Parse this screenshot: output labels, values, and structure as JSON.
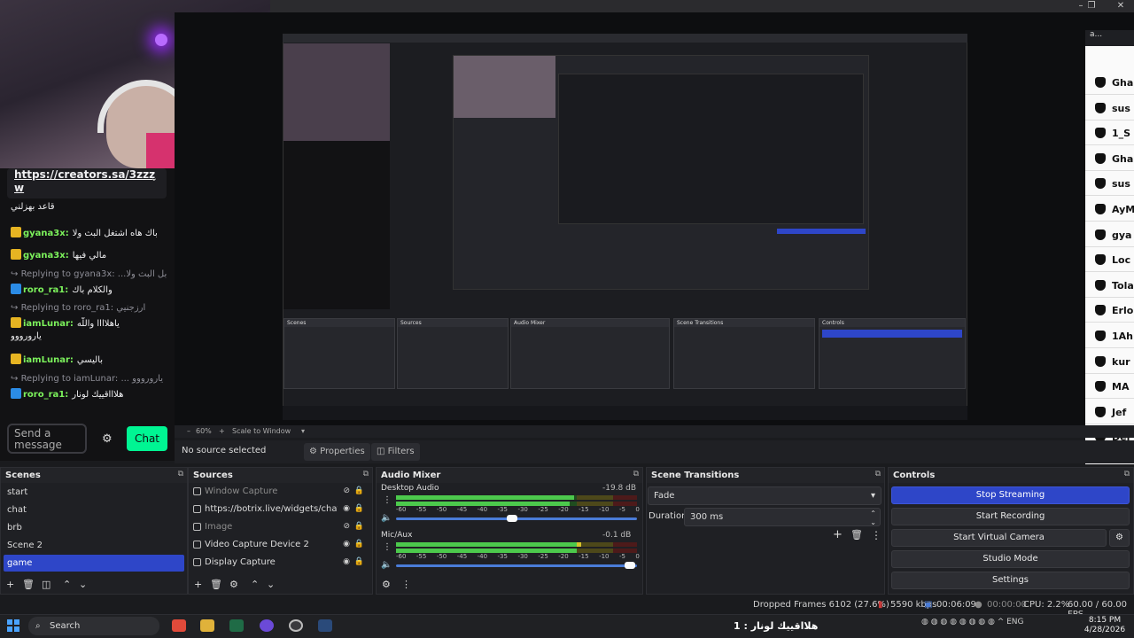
{
  "window": {
    "minimize": "–",
    "maximize": "❐",
    "close": "✕"
  },
  "chat": {
    "link": "https://creators.sa/3zzzw",
    "link_line1": "https://creators.sa/3zzz",
    "link_line2": "w",
    "messages": [
      {
        "kind": "text",
        "text": "قاعد بهزلني"
      },
      {
        "kind": "msg",
        "user": "gyana3x:",
        "text": "باك هاه اشتغل البث ولا",
        "user_color": "#7cf25c"
      },
      {
        "kind": "msg",
        "user": "gyana3x:",
        "text": "مالي فيها",
        "user_color": "#7cf25c"
      },
      {
        "kind": "reply",
        "text": "Replying to gyana3x: ...بل البث ولا"
      },
      {
        "kind": "msg",
        "user": "roro_ra1:",
        "text": "والكلام باك",
        "user_color": "#7cf25c"
      },
      {
        "kind": "reply",
        "text": "Replying to roro_ra1: ارزجنيي"
      },
      {
        "kind": "msg",
        "user": "iamLunar:",
        "text": "ياهلاااا واللّه",
        "user_color": "#7cf25c"
      },
      {
        "kind": "text",
        "text": "يارورووو"
      },
      {
        "kind": "msg",
        "user": "iamLunar:",
        "text": "باليسي",
        "user_color": "#7cf25c"
      },
      {
        "kind": "reply",
        "text": "Replying to iamLunar: ... يارورووو"
      },
      {
        "kind": "msg",
        "user": "roro_ra1:",
        "text": "هلاااقييك لونار",
        "user_color": "#7cf25c"
      }
    ],
    "input_placeholder": "Send a message",
    "chat_button": "Chat"
  },
  "right_chat": {
    "header": "a...",
    "rows": [
      "Gha",
      "sus",
      "1_S",
      "Gha",
      "sus",
      "AyM",
      "gya",
      "Loc",
      "Tola",
      "Erlo",
      "1Ah",
      "kur",
      "MA",
      "Jef",
      "Del"
    ]
  },
  "obs": {
    "zoom": "60%",
    "scale_label": "Scale to Window",
    "no_source": "No source selected",
    "properties": "Properties",
    "filters": "Filters",
    "scenes": {
      "title": "Scenes",
      "items": [
        "start",
        "chat",
        "brb",
        "Scene 2",
        "game"
      ],
      "selected": "game"
    },
    "sources": {
      "title": "Sources",
      "items": [
        {
          "name": "Window Capture",
          "hidden": true
        },
        {
          "name": "https://botrix.live/widgets/chat/?bid=",
          "hidden": false
        },
        {
          "name": "Image",
          "hidden": true
        },
        {
          "name": "Video Capture Device 2",
          "hidden": false
        },
        {
          "name": "Display Capture",
          "hidden": false
        }
      ]
    },
    "mixer": {
      "title": "Audio Mixer",
      "channels": [
        {
          "name": "Desktop Audio",
          "db": "-19.8 dB",
          "level": 0.74,
          "fader": 0.48
        },
        {
          "name": "Mic/Aux",
          "db": "-0.1 dB",
          "level": 0.77,
          "fader": 0.97
        }
      ],
      "ticks": [
        "-60",
        "-55",
        "-50",
        "-45",
        "-40",
        "-35",
        "-30",
        "-25",
        "-20",
        "-15",
        "-10",
        "-5",
        "0"
      ]
    },
    "transitions": {
      "title": "Scene Transitions",
      "selected": "Fade",
      "duration_label": "Duration",
      "duration_value": "300 ms"
    },
    "controls": {
      "title": "Controls",
      "buttons": [
        "Stop Streaming",
        "Start Recording",
        "Start Virtual Camera",
        "Studio Mode",
        "Settings"
      ]
    },
    "status": {
      "dropped": "Dropped Frames 6102 (27.6%)",
      "bitrate": "5590 kbps",
      "stream_time": "00:06:09",
      "rec_time": "00:00:00",
      "cpu": "CPU: 2.2%",
      "fps": "60.00 / 60.00 FPS"
    }
  },
  "taskbar": {
    "search": "Search",
    "now_playing": "هلااقييك لونار : 1",
    "lang": "ENG",
    "time": "8:15 PM",
    "date": "4/28/2026"
  },
  "colors": {
    "accent": "#2e46c8",
    "chat_green": "#00f593",
    "meter_green": "#4cc94c",
    "meter_yellow": "#d6c22b",
    "meter_red": "#c93a3a"
  }
}
